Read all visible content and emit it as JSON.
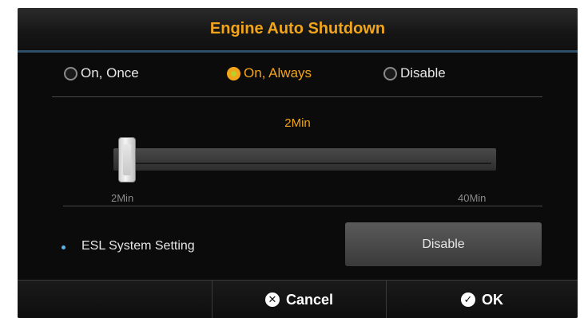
{
  "dialog": {
    "title": "Engine Auto Shutdown",
    "options": [
      {
        "label": "On, Once",
        "selected": false
      },
      {
        "label": "On, Always",
        "selected": true
      },
      {
        "label": "Disable",
        "selected": false
      }
    ],
    "slider": {
      "current_label": "2Min",
      "min_label": "2Min",
      "max_label": "40Min",
      "value_minutes": 2,
      "min_minutes": 2,
      "max_minutes": 40
    },
    "esl": {
      "label": "ESL System Setting",
      "button_label": "Disable"
    },
    "footer": {
      "cancel_label": "Cancel",
      "ok_label": "OK"
    }
  },
  "colors": {
    "accent": "#f2a51b",
    "radio_selected_center": "#b4d32a",
    "bullet": "#58b4e8",
    "title_underline": "#2f4e67"
  },
  "icons": {
    "cancel": "x-circle-icon",
    "ok": "check-circle-icon"
  }
}
